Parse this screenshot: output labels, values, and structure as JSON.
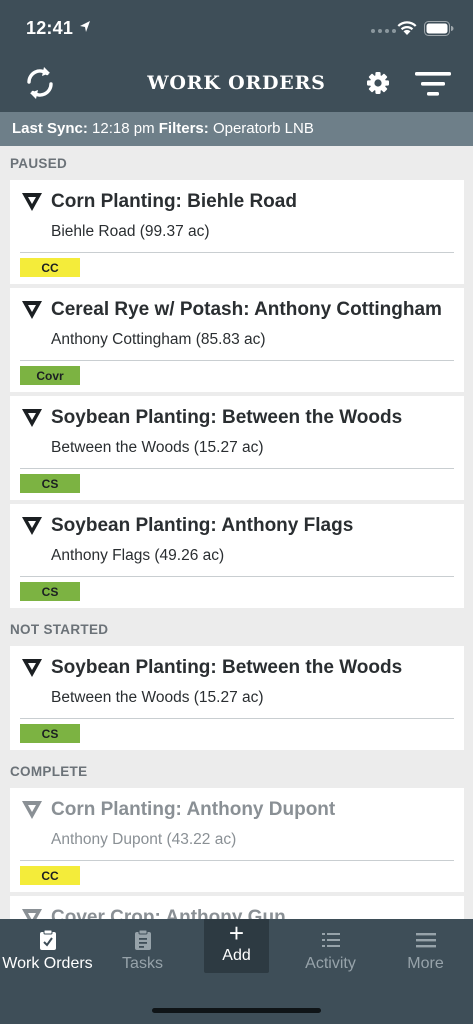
{
  "status_bar": {
    "time": "12:41"
  },
  "header": {
    "title": "WORK ORDERS"
  },
  "sync_bar": {
    "last_sync_label": "Last Sync:",
    "last_sync_value": "12:18 pm",
    "filters_label": "Filters:",
    "filters_value": "Operatorb LNB"
  },
  "sections": [
    {
      "title": "PAUSED",
      "items": [
        {
          "title": "Corn Planting: Biehle Road",
          "subtitle": "Biehle Road (99.37 ac)",
          "tag": "CC",
          "tag_color": "#f4ec3a"
        },
        {
          "title": "Cereal Rye w/ Potash: Anthony Cottingham",
          "subtitle": "Anthony Cottingham (85.83 ac)",
          "tag": "Covr",
          "tag_color": "#7cb342"
        },
        {
          "title": "Soybean Planting: Between the Woods",
          "subtitle": "Between the Woods (15.27 ac)",
          "tag": "CS",
          "tag_color": "#7cb342"
        },
        {
          "title": "Soybean Planting: Anthony Flags",
          "subtitle": "Anthony Flags (49.26 ac)",
          "tag": "CS",
          "tag_color": "#7cb342"
        }
      ]
    },
    {
      "title": "NOT STARTED",
      "items": [
        {
          "title": "Soybean Planting: Between the Woods",
          "subtitle": "Between the Woods (15.27 ac)",
          "tag": "CS",
          "tag_color": "#7cb342"
        }
      ]
    },
    {
      "title": "COMPLETE",
      "items": [
        {
          "title": "Corn Planting: Anthony Dupont",
          "subtitle": "Anthony Dupont (43.22 ac)",
          "tag": "CC",
          "tag_color": "#f4ec3a"
        },
        {
          "title": "Cover Crop: Anthony Gun",
          "subtitle": "",
          "tag": "",
          "tag_color": ""
        }
      ]
    }
  ],
  "tabbar": {
    "work_orders": "Work Orders",
    "tasks": "Tasks",
    "add": "Add",
    "activity": "Activity",
    "more": "More"
  },
  "colors": {
    "header_bg": "#3e4e58",
    "sync_bar_bg": "#6e7f89",
    "tag_yellow": "#f4ec3a",
    "tag_green": "#7cb342"
  }
}
